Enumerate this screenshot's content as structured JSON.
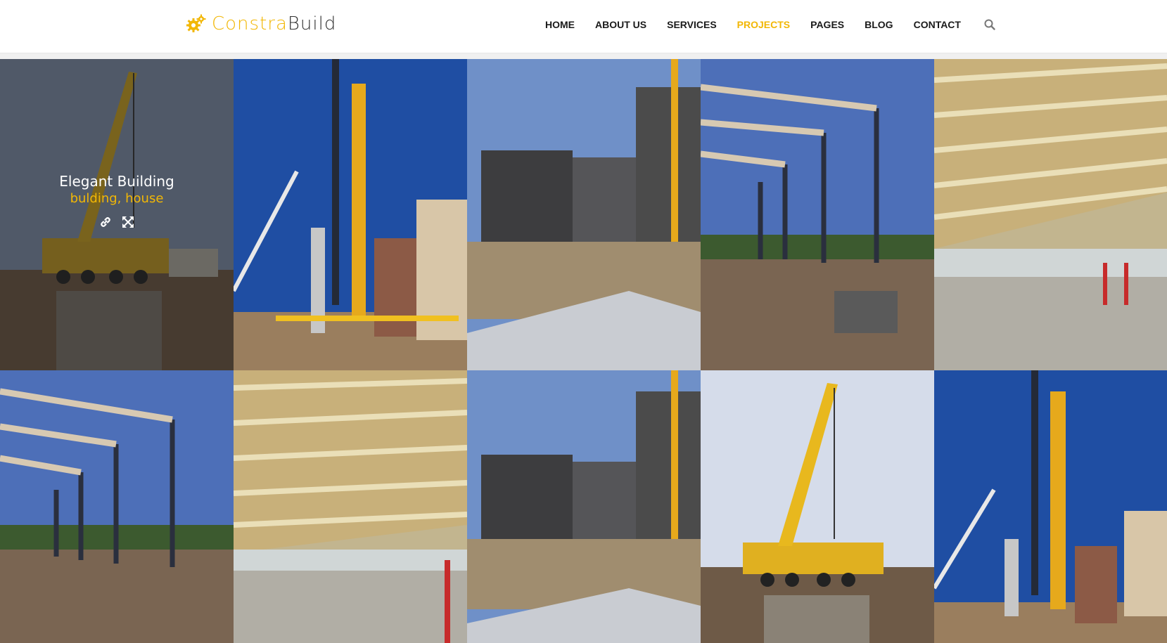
{
  "brand": {
    "name_part1": "Constra",
    "name_part2": "Build",
    "accent_color": "#f2b705",
    "logo_icon": "gears-icon"
  },
  "nav": {
    "items": [
      {
        "label": "HOME",
        "active": false
      },
      {
        "label": "ABOUT US",
        "active": false
      },
      {
        "label": "SERVICES",
        "active": false
      },
      {
        "label": "PROJECTS",
        "active": true
      },
      {
        "label": "PAGES",
        "active": false
      },
      {
        "label": "BLOG",
        "active": false
      },
      {
        "label": "CONTACT",
        "active": false
      }
    ],
    "search_icon": "search-icon"
  },
  "gallery": {
    "hovered_item": {
      "title": "Elegant Building",
      "tags": "bulding, house",
      "actions": [
        "link-icon",
        "expand-icon"
      ]
    },
    "tiles": [
      {
        "scene": "crane"
      },
      {
        "scene": "tower-crane"
      },
      {
        "scene": "scaffold-building"
      },
      {
        "scene": "steel-frame"
      },
      {
        "scene": "wood-truss"
      },
      {
        "scene": "steel-frame"
      },
      {
        "scene": "wood-truss"
      },
      {
        "scene": "scaffold-building"
      },
      {
        "scene": "crane"
      },
      {
        "scene": "tower-crane"
      }
    ]
  }
}
